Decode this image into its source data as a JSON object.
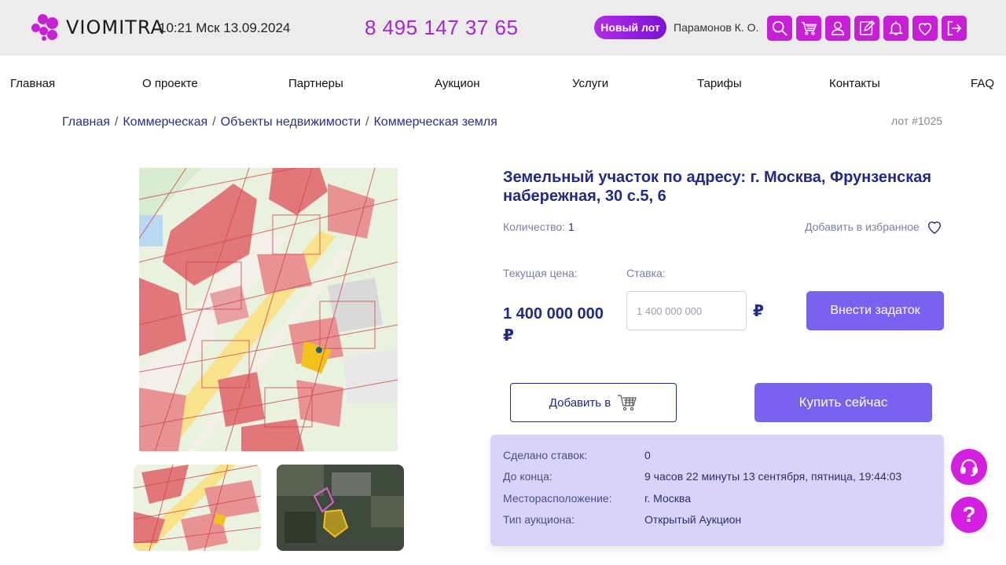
{
  "header": {
    "logo_text": "VIOMITRA",
    "datetime": "10:21 Мск 13.09.2024",
    "phone": "8 495 147 37 65",
    "new_lot_label": "Новый лот",
    "user_name": "Парамонов К. О.",
    "icons": [
      "search-icon",
      "cart-icon",
      "user-icon",
      "edit-icon",
      "bell-icon",
      "heart-icon",
      "logout-icon"
    ],
    "accent_color": "#c81ed8"
  },
  "nav": {
    "items": [
      "Главная",
      "О проекте",
      "Партнеры",
      "Аукцион",
      "Услуги",
      "Тарифы",
      "Контакты",
      "FAQ"
    ]
  },
  "breadcrumb": {
    "items": [
      "Главная",
      "Коммерческая",
      "Объекты недвижимости",
      "Коммерческая земля"
    ],
    "separator": "/"
  },
  "lot": {
    "number": "лот #1025",
    "title": "Земельный участок по адресу: г. Москва, Фрунзенская набережная, 30 с.5, 6",
    "quantity_label": "Количество:",
    "quantity_value": "1",
    "favorite_label": "Добавить в избранное",
    "current_price_label": "Текущая цена:",
    "current_price": "1 400 000 000 ₽",
    "bid_label": "Ставка:",
    "bid_placeholder": "1 400 000 000",
    "currency": "₽",
    "deposit_button": "Внести задаток",
    "add_to_cart_button": "Добавить в",
    "buy_now_button": "Купить сейчас"
  },
  "info": {
    "rows": [
      {
        "key": "Сделано ставок:",
        "value": "0"
      },
      {
        "key": "До конца:",
        "value": "9 часов 22 минуты 13 сентября, пятница, 19:44:03"
      },
      {
        "key": "Месторасположение:",
        "value": "г. Москва"
      },
      {
        "key": "Тип аукциона:",
        "value": "Открытый Аукцион"
      }
    ]
  },
  "floating": {
    "support_icon": "headset-icon",
    "help_label": "?"
  },
  "colors": {
    "primary_button": "#7b61f0",
    "title_blue": "#21298a",
    "info_bg": "#d9d3fa",
    "header_bg": "#ececec"
  }
}
